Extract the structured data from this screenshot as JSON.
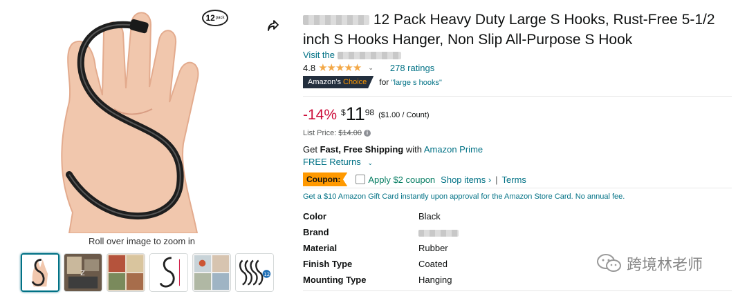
{
  "gallery": {
    "badge": "12",
    "badge_sub": "pack",
    "zoom_hint": "Roll over image to zoom in",
    "thumb_badge": "12"
  },
  "product": {
    "title": "12 Pack Heavy Duty Large S Hooks, Rust-Free 5-1/2 inch S Hooks Hanger, Non Slip All-Purpose S Hook",
    "visit_prefix": "Visit the",
    "rating_value": "4.8",
    "stars": "★★★★★",
    "ratings_count": "278 ratings",
    "choice_part1": "Amazon's",
    "choice_part2": "Choice",
    "choice_for": "for",
    "choice_keyword": "\"large s hooks\"",
    "discount": "-14%",
    "price_symbol": "$",
    "price_whole": "11",
    "price_fraction": "98",
    "unit_price": "($1.00 / Count)",
    "list_price_label": "List Price:",
    "list_price": "$14.00",
    "shipping_get": "Get",
    "shipping_bold": "Fast, Free Shipping",
    "shipping_with": "with",
    "shipping_prime": "Amazon Prime",
    "returns": "FREE Returns",
    "coupon_label": "Coupon:",
    "coupon_text": "Apply $2 coupon",
    "shop_items": "Shop items ›",
    "separator": "|",
    "terms": "Terms",
    "gift_card": "Get a $10 Amazon Gift Card instantly upon approval for the Amazon Store Card. No annual fee."
  },
  "specs": [
    {
      "key": "Color",
      "value": "Black"
    },
    {
      "key": "Brand",
      "value": ""
    },
    {
      "key": "Material",
      "value": "Rubber"
    },
    {
      "key": "Finish Type",
      "value": "Coated"
    },
    {
      "key": "Mounting Type",
      "value": "Hanging"
    }
  ],
  "watermark": "跨境林老师",
  "colors": {
    "link": "#007185",
    "discount": "#cc0c39",
    "star": "#f3a847",
    "coupon": "#ff9900",
    "choice_bg": "#232f3e"
  }
}
